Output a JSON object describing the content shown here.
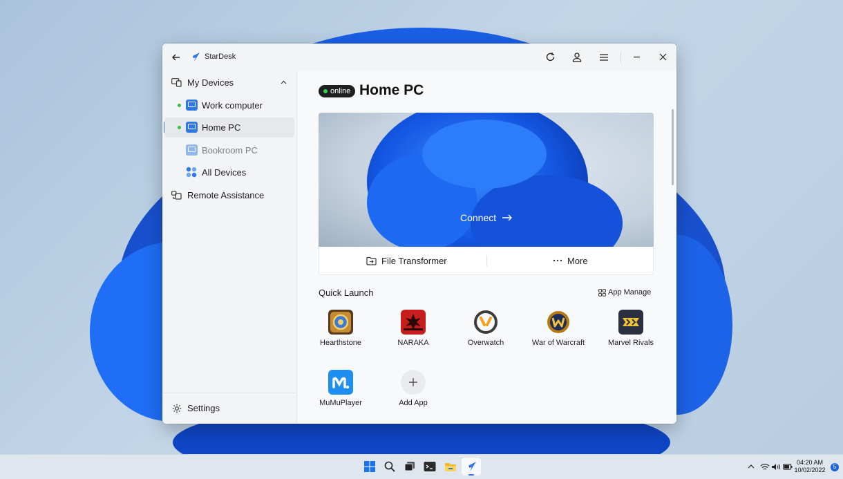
{
  "app": {
    "title": "StarDesk"
  },
  "sidebar": {
    "my_devices": "My Devices",
    "devices": [
      {
        "label": "Work computer",
        "online": true
      },
      {
        "label": "Home PC",
        "online": true,
        "active": true
      },
      {
        "label": "Bookroom PC",
        "online": false
      }
    ],
    "all_devices": "All Devices",
    "remote_assistance": "Remote Assistance",
    "settings": "Settings"
  },
  "device": {
    "status": "online",
    "name": "Home PC",
    "connect_label": "Connect",
    "file_transformer": "File Transformer",
    "more": "More"
  },
  "quick_launch": {
    "title": "Quick Launch",
    "app_manage": "App Manage",
    "apps": [
      {
        "label": "Hearthstone"
      },
      {
        "label": "NARAKA"
      },
      {
        "label": "Overwatch"
      },
      {
        "label": "War of Warcraft"
      },
      {
        "label": "Marvel Rivals"
      },
      {
        "label": "MuMuPlayer"
      },
      {
        "label": "Add App"
      }
    ]
  },
  "taskbar": {
    "time": "04:20 AM",
    "date": "10/02/2022",
    "notifications": "5"
  },
  "colors": {
    "accent": "#2f78e8",
    "online": "#33c04a"
  }
}
